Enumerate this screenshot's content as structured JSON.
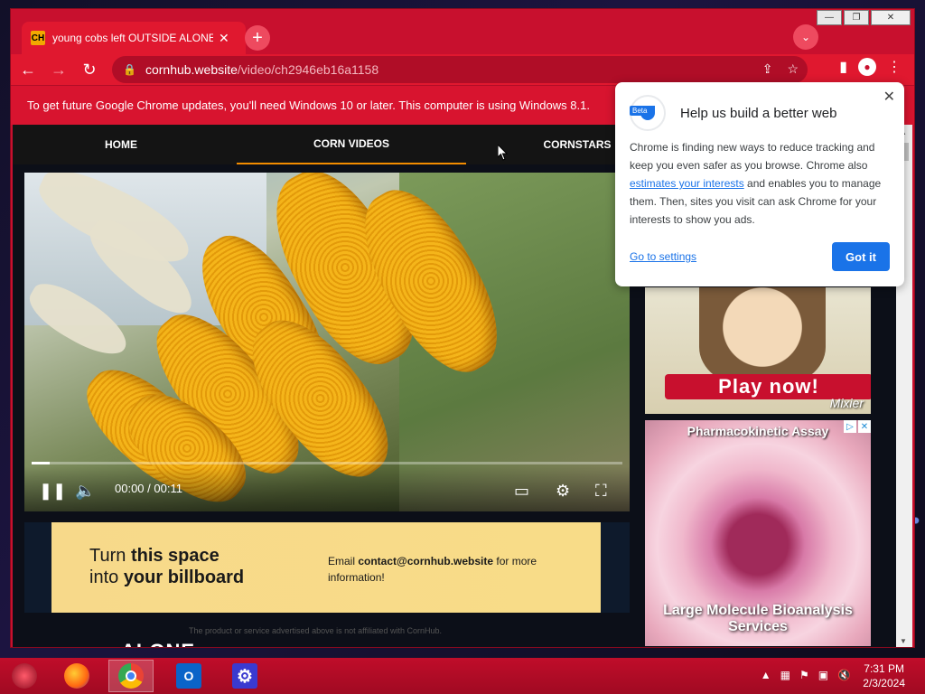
{
  "browser": {
    "tab_title": "young cobs left OUTSIDE ALONE",
    "tab_favicon": "CH",
    "url_host": "cornhub.website",
    "url_path": "/video/ch2946eb16a1158",
    "infobar": "To get future Google Chrome updates, you'll need Windows 10 or later. This computer is using Windows 8.1."
  },
  "site_nav": {
    "items": [
      "HOME",
      "CORN VIDEOS",
      "CORNSTARS"
    ],
    "active": "CORN VIDEOS",
    "active_color": "#f28c00"
  },
  "video": {
    "time": "00:00 / 00:11",
    "progress": 0.03
  },
  "billboard": {
    "line1_a": "Turn ",
    "line1_b": "this space",
    "line2_a": "into ",
    "line2_b": "your billboard",
    "email_prefix": "Email ",
    "email": "contact@cornhub.website",
    "email_suffix": " for more information!",
    "disclaimer": "The product or service advertised above is not affiliated with CornHub."
  },
  "page_title_peek": "ALONE",
  "ads": {
    "ad1_button": "Play now!",
    "ad1_brand": "Mixier",
    "ad2_title": "Pharmacokinetic Assay",
    "ad2_sub": "Large Molecule Bioanalysis Services"
  },
  "popup": {
    "beta": "Beta",
    "title": "Help us build a better web",
    "body_1": "Chrome is finding new ways to reduce tracking and keep you even safer as you browse. Chrome also ",
    "body_link": "estimates your interests",
    "body_2": " and enables you to manage them. Then, sites you visit can ask Chrome for your interests to show you ads.",
    "settings_link": "Go to settings",
    "got_it": "Got it"
  },
  "taskbar": {
    "time": "7:31 PM",
    "date": "2/3/2024",
    "outlook_letter": "O"
  },
  "colors": {
    "chrome_red": "#c8102e",
    "accent_blue": "#1a73e8"
  }
}
